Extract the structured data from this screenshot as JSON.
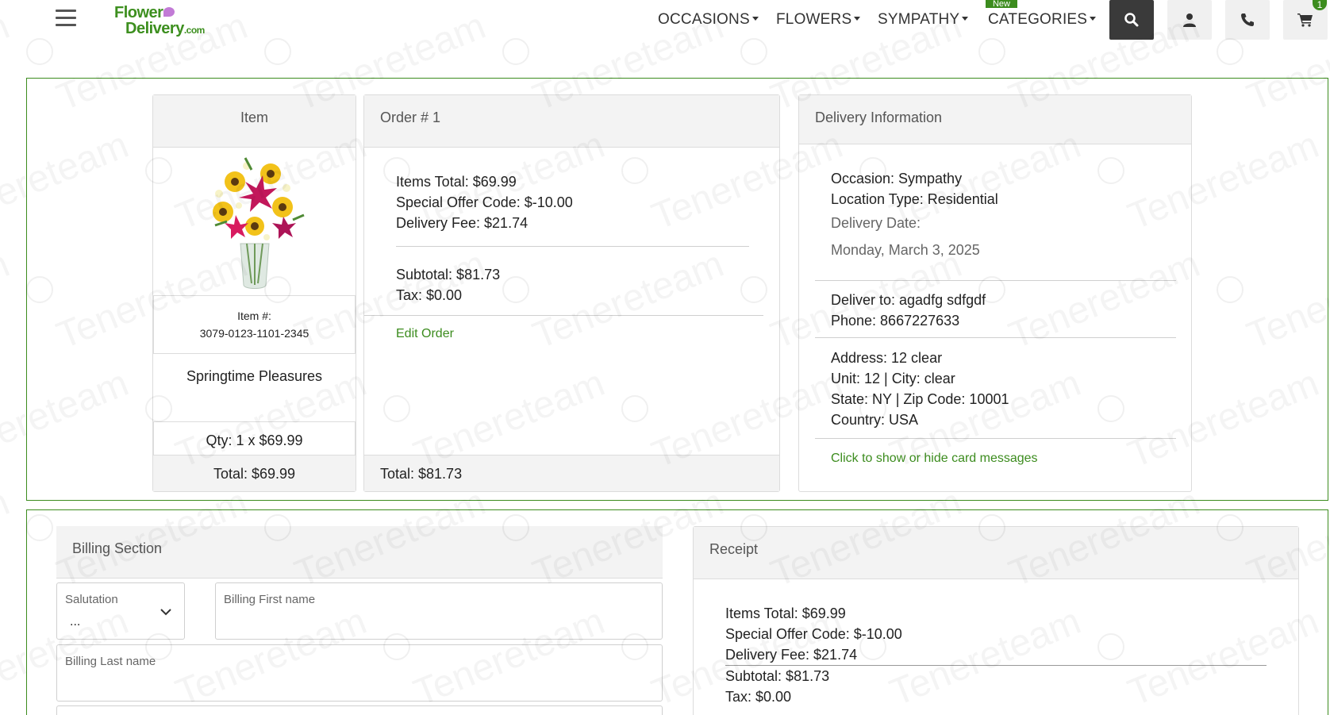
{
  "header": {
    "logo_line1": "Flower",
    "logo_line2": "Delivery",
    "logo_suffix": ".com",
    "nav": [
      {
        "label": "OCCASIONS"
      },
      {
        "label": "FLOWERS"
      },
      {
        "label": "SYMPATHY"
      },
      {
        "label": "CATEGORIES"
      }
    ],
    "new_badge": "New",
    "cart_count": "1",
    "icons": [
      "hamburger-icon",
      "search-icon",
      "user-icon",
      "phone-icon",
      "cart-icon"
    ]
  },
  "item_card": {
    "heading": "Item",
    "item_number_label": "Item #:",
    "item_number": "3079-0123-1101-2345",
    "product_name": "Springtime Pleasures",
    "qty": "Qty: 1 x $69.99",
    "total": "Total: $69.99"
  },
  "order_card": {
    "heading": "Order # 1",
    "items_total": "Items Total: $69.99",
    "special_offer": "Special Offer Code: $-10.00",
    "delivery_fee": "Delivery Fee: $21.74",
    "subtotal": "Subtotal: $81.73",
    "tax": "Tax: $0.00",
    "edit_link": "Edit Order",
    "total": "Total: $81.73"
  },
  "delivery_card": {
    "heading": "Delivery Information",
    "occasion": "Occasion: Sympathy",
    "location_type": "Location Type: Residential",
    "delivery_date_label": "Delivery Date:",
    "delivery_date": "Monday, March 3, 2025",
    "deliver_to": "Deliver to: agadfg sdfgdf",
    "phone": "Phone: 8667227633",
    "address": "Address: 12 clear",
    "unit_city": "Unit: 12 | City: clear",
    "state_zip": "State: NY | Zip Code: 10001",
    "country": "Country: USA",
    "card_messages_link": "Click to show or hide card messages"
  },
  "billing": {
    "heading": "Billing Section",
    "salutation_label": "Salutation",
    "salutation_value": "...",
    "first_name_label": "Billing First name",
    "last_name_label": "Billing Last name"
  },
  "receipt": {
    "heading": "Receipt",
    "items_total": "Items Total: $69.99",
    "special_offer": "Special Offer Code: $-10.00",
    "delivery_fee": "Delivery Fee: $21.74",
    "subtotal": "Subtotal: $81.73",
    "tax": "Tax: $0.00"
  },
  "colors": {
    "brand_green": "#3c8c1e",
    "dark_button": "#3a3a3a"
  },
  "watermark_text": "Tenereteam"
}
